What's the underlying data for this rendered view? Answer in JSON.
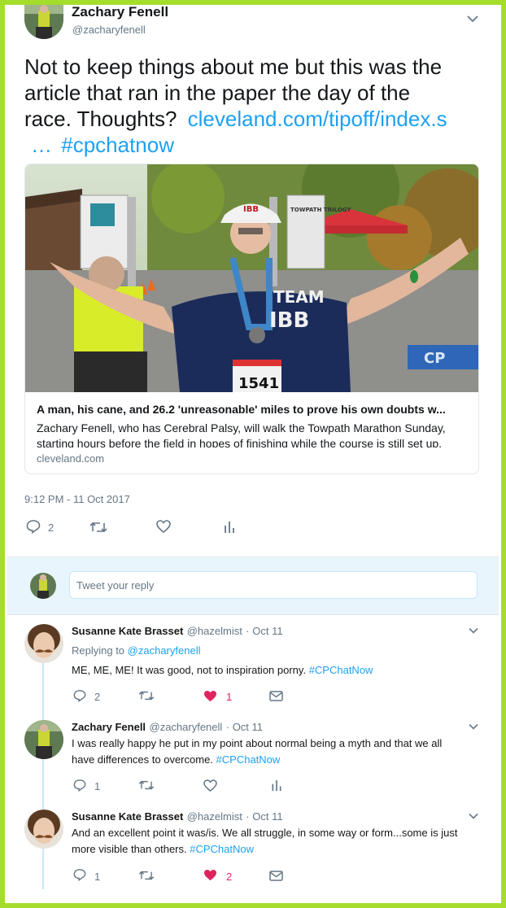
{
  "main_tweet": {
    "name": "Zachary Fenell",
    "handle": "@zacharyfenell",
    "text_line1": "Not to keep things about me but this was the",
    "text_line2": "article that ran in the paper the day of the",
    "text_line3_prefix": "race. Thoughts?",
    "link_text": "cleveland.com/tipoff/index.s",
    "link_ellipsis": "…",
    "hashtag": "#cpchatnow",
    "timestamp": "9:12 PM - 11 Oct 2017",
    "reply_count": "2"
  },
  "card": {
    "title": "A man, his cane, and 26.2 'unreasonable' miles to prove his own doubts w...",
    "description": "Zachary Fenell, who has Cerebral Palsy, will walk the Towpath Marathon Sunday, starting hours before the field in hopes of finishing while the course is still set up.",
    "domain": "cleveland.com",
    "image_text": {
      "tent": "TOWPATH TRILOGY",
      "cap": "IBB",
      "shirt_line1": "TEAM",
      "shirt_line2": "IBB",
      "bib": "1541",
      "parking": "CP"
    }
  },
  "reply_box": {
    "placeholder": "Tweet your reply"
  },
  "replies": [
    {
      "name": "Susanne Kate Brasset",
      "handle": "@hazelmist",
      "time": "· Oct 11",
      "replying_prefix": "Replying to",
      "replying_to": "@zacharyfenell",
      "text": "ME, ME, ME! It was good, not to inspiration porny.",
      "hashtag": "#CPChatNow",
      "reply_count": "2",
      "like_count": "1"
    },
    {
      "name": "Zachary Fenell",
      "handle": "@zacharyfenell",
      "time": "· Oct 11",
      "text_line1": "I was really happy he put in my point about normal being a myth and that we all",
      "text_line2": "have differences to overcome.",
      "hashtag": "#CPChatNow",
      "reply_count": "1"
    },
    {
      "name": "Susanne Kate Brasset",
      "handle": "@hazelmist",
      "time": "· Oct 11",
      "text_line1": "And an excellent point it was/is. We all struggle, in some way or form...some is just",
      "text_line2": "more visible than others.",
      "hashtag": "#CPChatNow",
      "reply_count": "1",
      "like_count": "2"
    }
  ],
  "colors": {
    "frame": "#a4dd2c",
    "link": "#1da1f2",
    "like": "#e0245e",
    "muted": "#657786"
  }
}
